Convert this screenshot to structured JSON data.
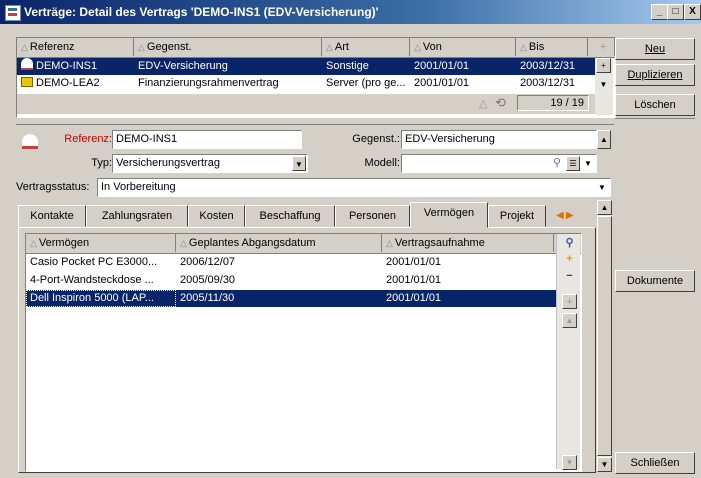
{
  "window": {
    "title": "Verträge: Detail des Vertrags 'DEMO-INS1 (EDV-Versicherung)'",
    "controls": [
      "_",
      "□",
      "X"
    ]
  },
  "contracts_table": {
    "columns": [
      "Referenz",
      "Gegenst.",
      "Art",
      "Von",
      "Bis"
    ],
    "rows": [
      {
        "referenz": "DEMO-INS1",
        "gegenst": "EDV-Versicherung",
        "art": "Sonstige",
        "von": "2001/01/01",
        "bis": "2003/12/31",
        "selected": true
      },
      {
        "referenz": "DEMO-LEA2",
        "gegenst": "Finanzierungsrahmenvertrag",
        "art": "Server (pro ge...",
        "von": "2001/01/01",
        "bis": "2003/12/31",
        "selected": false
      }
    ],
    "count": "19 / 19"
  },
  "right_buttons": {
    "neu": "Neu",
    "duplizieren": "Duplizieren",
    "loeschen": "Löschen",
    "dokumente": "Dokumente",
    "schliessen": "Schließen"
  },
  "detail": {
    "referenz_label": "Referenz:",
    "referenz_value": "DEMO-INS1",
    "gegenst_label": "Gegenst.:",
    "gegenst_value": "EDV-Versicherung",
    "typ_label": "Typ:",
    "typ_value": "Versicherungsvertrag",
    "modell_label": "Modell:",
    "modell_value": "",
    "status_label": "Vertragsstatus:",
    "status_value": "In Vorbereitung"
  },
  "tabs": [
    "Kontakte",
    "Zahlungsraten",
    "Kosten",
    "Beschaffung",
    "Personen",
    "Vermögen",
    "Projekt"
  ],
  "active_tab": "Vermögen",
  "assets_table": {
    "columns": [
      "Vermögen",
      "Geplantes Abgangsdatum",
      "Vertragsaufnahme"
    ],
    "rows": [
      {
        "vermoegen": "Casio Pocket PC E3000...",
        "abgang": "2006/12/07",
        "aufnahme": "2001/01/01",
        "selected": false
      },
      {
        "vermoegen": "4-Port-Wandsteckdose ...",
        "abgang": "2005/09/30",
        "aufnahme": "2001/01/01",
        "selected": false
      },
      {
        "vermoegen": "Dell Inspiron 5000 (LAP...",
        "abgang": "2005/11/30",
        "aufnahme": "2001/01/01",
        "selected": true
      }
    ]
  },
  "colors": {
    "selection": "#0a246a",
    "window_bg": "#d4d0c8",
    "referenz_label": "#c00000"
  }
}
